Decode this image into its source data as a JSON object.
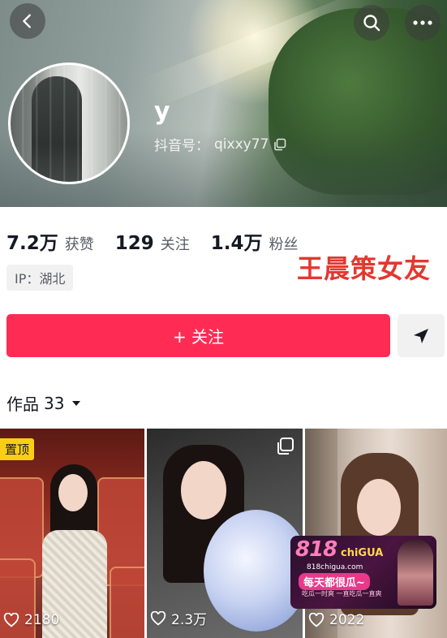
{
  "profile": {
    "username": "y",
    "douyin_id_label": "抖音号：",
    "douyin_id": "qixxy77"
  },
  "stats": [
    {
      "value": "7.2万",
      "label": "获赞"
    },
    {
      "value": "129",
      "label": "关注"
    },
    {
      "value": "1.4万",
      "label": "粉丝"
    }
  ],
  "ip_tag": "IP：湖北",
  "overlay_caption": "王晨策女友",
  "actions": {
    "follow_label": "+ 关注"
  },
  "works": {
    "label": "作品",
    "count": "33"
  },
  "videos": [
    {
      "pinned_label": "置顶",
      "likes": "2180"
    },
    {
      "likes": "2.3万"
    },
    {
      "likes": "2022"
    }
  ],
  "watermark": {
    "brand": "818",
    "brand_suffix": "chiGUA",
    "site": "818chigua.com",
    "slogan": "每天都很瓜~",
    "subtext": "吃瓜一时爽 一直吃瓜一直爽"
  },
  "colors": {
    "accent": "#fe2c55",
    "caption": "#e2382f",
    "pin": "#face15"
  }
}
